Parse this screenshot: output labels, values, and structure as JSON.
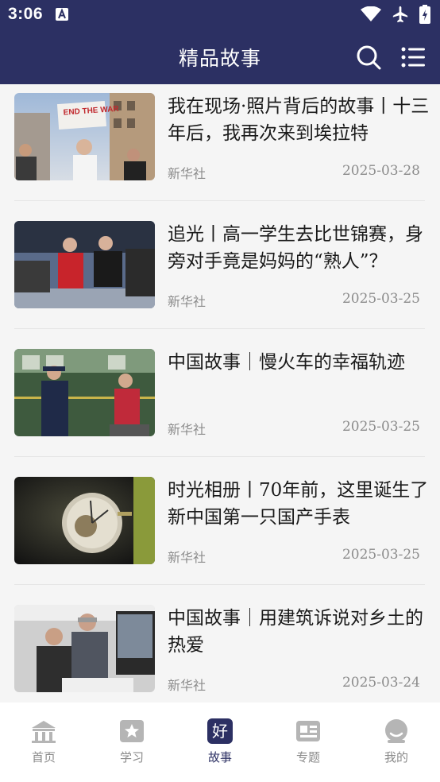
{
  "status_bar": {
    "time": "3:06"
  },
  "header": {
    "title": "精品故事"
  },
  "articles": [
    {
      "title": "我在现场·照片背后的故事丨十三年后，我再次来到埃拉特",
      "source": "新华社",
      "date": "2025-03-28",
      "image_sign": "END THE WAR"
    },
    {
      "title": "追光丨高一学生去比世锦赛，身旁对手竟是妈妈的“熟人”？",
      "source": "新华社",
      "date": "2025-03-25"
    },
    {
      "title": "中国故事｜慢火车的幸福轨迹",
      "source": "新华社",
      "date": "2025-03-25"
    },
    {
      "title": "时光相册丨70年前，这里诞生了新中国第一只国产手表",
      "source": "新华社",
      "date": "2025-03-25"
    },
    {
      "title": "中国故事｜用建筑诉说对乡土的热爱",
      "source": "新华社",
      "date": "2025-03-24"
    }
  ],
  "bottom_nav": [
    {
      "label": "首页",
      "icon": "home-icon",
      "active": false
    },
    {
      "label": "学习",
      "icon": "star-book-icon",
      "active": false
    },
    {
      "label": "故事",
      "icon": "hao-icon",
      "glyph": "好",
      "active": true
    },
    {
      "label": "专题",
      "icon": "topic-card-icon",
      "active": false
    },
    {
      "label": "我的",
      "icon": "profile-icon",
      "active": false
    }
  ],
  "colors": {
    "header_bg": "#2c3063",
    "active_nav": "#2c3063",
    "inactive_nav": "#b5b5b5",
    "page_bg": "#f5f5f5"
  }
}
